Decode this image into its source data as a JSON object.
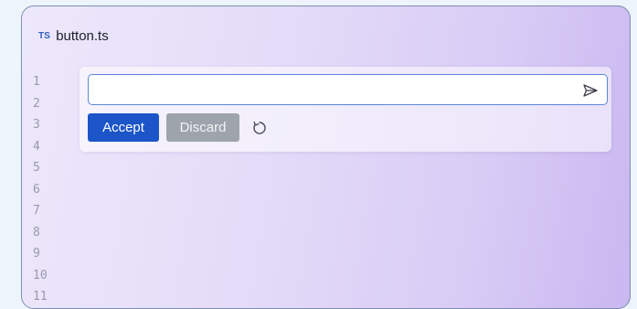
{
  "editor": {
    "file_badge": "TS",
    "file_name": "button.ts",
    "line_numbers": [
      "1",
      "2",
      "3",
      "4",
      "5",
      "6",
      "7",
      "8",
      "9",
      "10",
      "11"
    ]
  },
  "inline_prompt": {
    "value": "",
    "placeholder": "",
    "send_icon": "send-icon",
    "accept_label": "Accept",
    "discard_label": "Discard",
    "regenerate_icon": "refresh-icon"
  },
  "colors": {
    "accent": "#1b55c7",
    "discard": "#9ea4ab",
    "ts_badge": "#2f5fc4"
  }
}
